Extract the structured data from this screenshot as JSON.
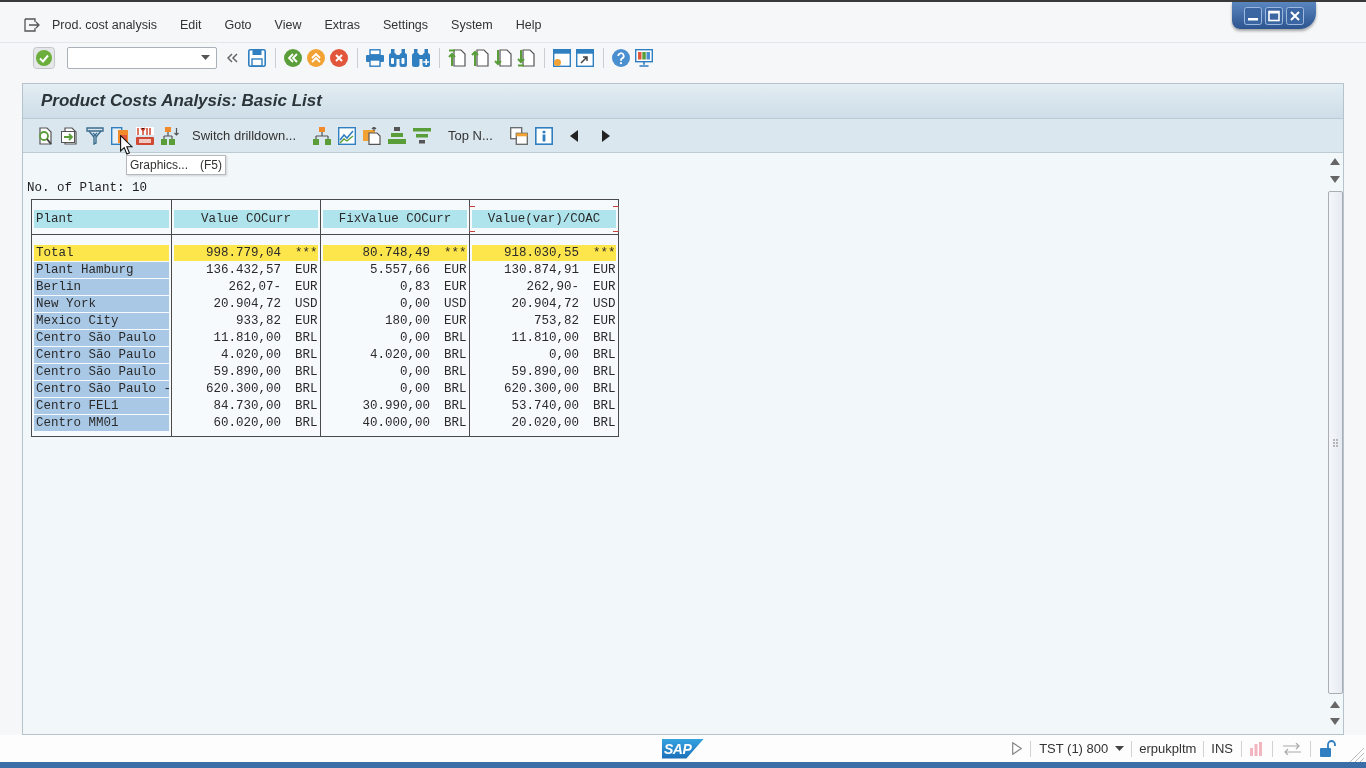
{
  "menu_bar": {
    "items": [
      "Prod. cost analysis",
      "Edit",
      "Goto",
      "View",
      "Extras",
      "Settings",
      "System",
      "Help"
    ]
  },
  "screen": {
    "title": "Product Costs Analysis: Basic List"
  },
  "app_toolbar": {
    "text_buttons": [
      "Switch drilldown...",
      "Top N..."
    ]
  },
  "tooltip": {
    "label": "Graphics...",
    "shortcut": "(F5)"
  },
  "list_header": "No. of Plant: 10",
  "table": {
    "columns": [
      {
        "label": "Plant",
        "focused": false
      },
      {
        "label": "Value COCurr",
        "focused": false
      },
      {
        "label": "FixValue COCurr",
        "focused": false
      },
      {
        "label": "Value(var)/COAC",
        "focused": true
      }
    ],
    "rows": [
      {
        "kind": "total",
        "plant": "Total",
        "values": [
          {
            "amount": "998.779,04",
            "currency": "***"
          },
          {
            "amount": "80.748,49",
            "currency": "***"
          },
          {
            "amount": "918.030,55",
            "currency": "***"
          }
        ]
      },
      {
        "kind": "plant",
        "plant": "Plant Hamburg",
        "values": [
          {
            "amount": "136.432,57",
            "currency": "EUR"
          },
          {
            "amount": "5.557,66",
            "currency": "EUR"
          },
          {
            "amount": "130.874,91",
            "currency": "EUR"
          }
        ]
      },
      {
        "kind": "plant",
        "plant": "Berlin",
        "values": [
          {
            "amount": "262,07-",
            "currency": "EUR"
          },
          {
            "amount": "0,83",
            "currency": "EUR"
          },
          {
            "amount": "262,90-",
            "currency": "EUR"
          }
        ]
      },
      {
        "kind": "plant",
        "plant": "New York",
        "values": [
          {
            "amount": "20.904,72",
            "currency": "USD"
          },
          {
            "amount": "0,00",
            "currency": "USD"
          },
          {
            "amount": "20.904,72",
            "currency": "USD"
          }
        ]
      },
      {
        "kind": "plant",
        "plant": "Mexico City",
        "values": [
          {
            "amount": "933,82",
            "currency": "EUR"
          },
          {
            "amount": "180,00",
            "currency": "EUR"
          },
          {
            "amount": "753,82",
            "currency": "EUR"
          }
        ]
      },
      {
        "kind": "plant",
        "plant": "Centro São Paulo",
        "values": [
          {
            "amount": "11.810,00",
            "currency": "BRL"
          },
          {
            "amount": "0,00",
            "currency": "BRL"
          },
          {
            "amount": "11.810,00",
            "currency": "BRL"
          }
        ]
      },
      {
        "kind": "plant",
        "plant": "Centro São Paulo",
        "values": [
          {
            "amount": "4.020,00",
            "currency": "BRL"
          },
          {
            "amount": "4.020,00",
            "currency": "BRL"
          },
          {
            "amount": "0,00",
            "currency": "BRL"
          }
        ]
      },
      {
        "kind": "plant",
        "plant": "Centro São Paulo",
        "values": [
          {
            "amount": "59.890,00",
            "currency": "BRL"
          },
          {
            "amount": "0,00",
            "currency": "BRL"
          },
          {
            "amount": "59.890,00",
            "currency": "BRL"
          }
        ]
      },
      {
        "kind": "plant",
        "plant": "Centro São Paulo -",
        "values": [
          {
            "amount": "620.300,00",
            "currency": "BRL"
          },
          {
            "amount": "0,00",
            "currency": "BRL"
          },
          {
            "amount": "620.300,00",
            "currency": "BRL"
          }
        ]
      },
      {
        "kind": "plant",
        "plant": "Centro FEL1",
        "values": [
          {
            "amount": "84.730,00",
            "currency": "BRL"
          },
          {
            "amount": "30.990,00",
            "currency": "BRL"
          },
          {
            "amount": "53.740,00",
            "currency": "BRL"
          }
        ]
      },
      {
        "kind": "plant",
        "plant": "Centro MM01",
        "values": [
          {
            "amount": "60.020,00",
            "currency": "BRL"
          },
          {
            "amount": "40.000,00",
            "currency": "BRL"
          },
          {
            "amount": "20.020,00",
            "currency": "BRL"
          }
        ]
      }
    ]
  },
  "status_bar": {
    "logo": "SAP",
    "system": "TST (1) 800",
    "user": "erpukpltm",
    "mode": "INS"
  }
}
